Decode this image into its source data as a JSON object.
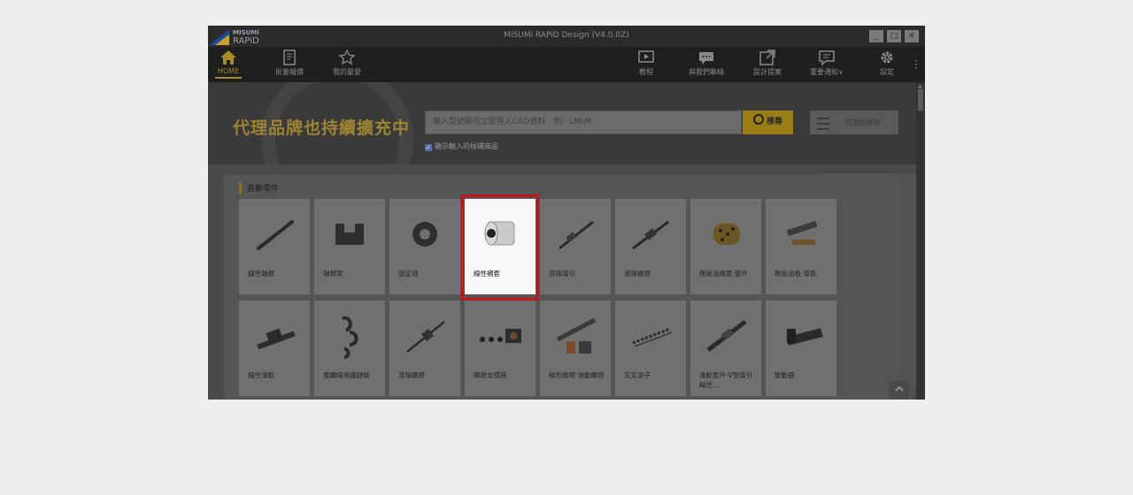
{
  "window": {
    "brand": "MISUMi",
    "product": "RAPiD Design",
    "title": "MiSUMi RAPiD Design (V4.0.0Z)",
    "controls": [
      "_",
      "□",
      "✕"
    ]
  },
  "toolbar": {
    "home": "HOME",
    "bulk_quote": "批量報價",
    "favorites": "我的最愛",
    "tutorial": "教程",
    "contact": "與我們聯絡",
    "design_report": "設計提案",
    "notice": "重要通知∨",
    "settings": "設定"
  },
  "banner": {
    "slogan": "代理品牌也持續擴充中",
    "search_placeholder": "輸入型號即可立即匯入CAD資料　例）LMU6",
    "search_button": "搜尋",
    "category_button": "從類別檢索",
    "checkbox_label": "顯示輸入的候補商品"
  },
  "section": {
    "title": "直動零件"
  },
  "tiles_row1": [
    "線性軸桿",
    "軸桿架",
    "固定環",
    "線性襯套",
    "滾珠導引",
    "滾珠螺桿",
    "無給油襯套·墊片",
    "無給油板·導軌"
  ],
  "tiles_row2": [
    "線性滑軌",
    "電纜線保護鏈條",
    "滾珠螺桿",
    "螺桿支撐座",
    "梯形螺桿·滑動螺桿",
    "交叉滾子",
    "滑動套件·V型導引·線性...",
    "致動器"
  ],
  "highlighted_tile": "線性襯套",
  "colors": {
    "accent": "#a88a2a",
    "highlight": "#c7141c"
  }
}
